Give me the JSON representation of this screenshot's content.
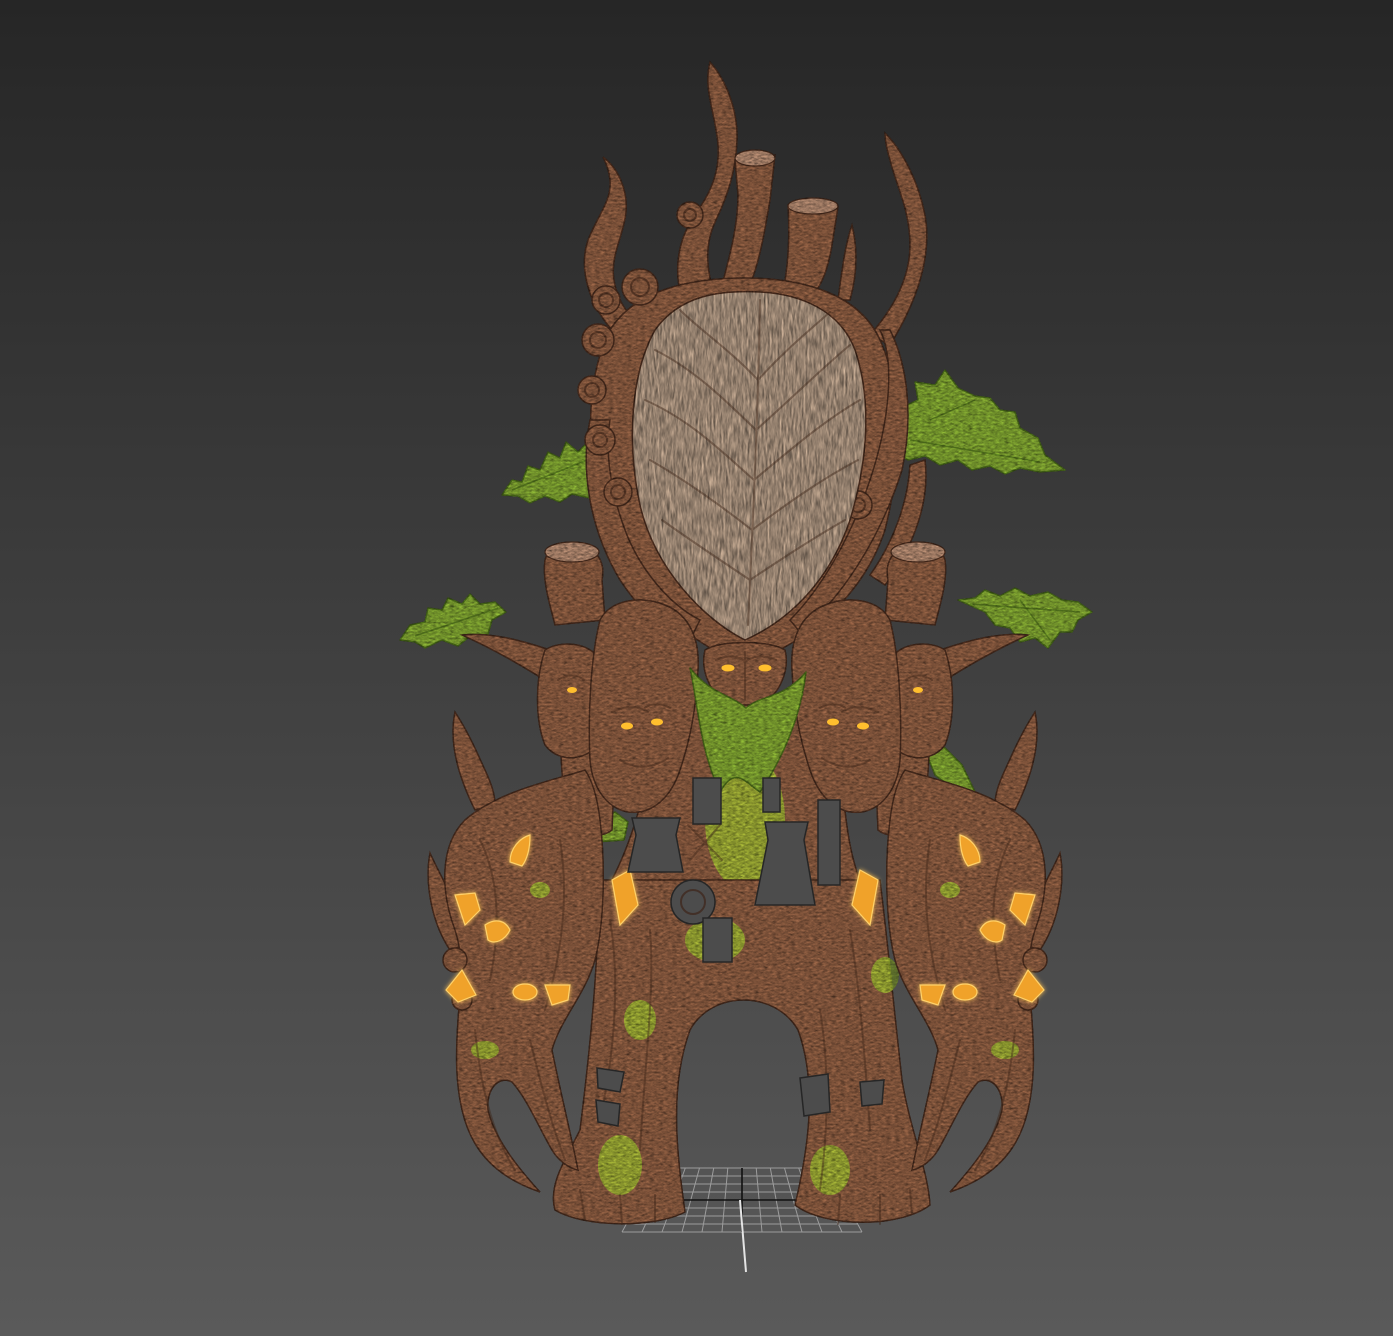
{
  "viewport": {
    "view": "perspective",
    "shading": "textured"
  },
  "colors": {
    "bg_top": "#262626",
    "bg_bottom": "#5a5a5a",
    "bark": "#7a5038",
    "bark_dark": "#3e2519",
    "bark_light": "#9a7660",
    "head": "#94806e",
    "leaf": "#6f8f2a",
    "leaf_dark": "#3f5c15",
    "moss": "#8fb02a",
    "glow": "#f0a22c",
    "glow_light": "#ffd26a",
    "eye": "#ffbf2e",
    "metal": "#4c4c4c",
    "metal_dark": "#262626",
    "grid": "#9c9c9c",
    "grid_axis": "#111111",
    "z_axis": "#e4e4e4"
  }
}
